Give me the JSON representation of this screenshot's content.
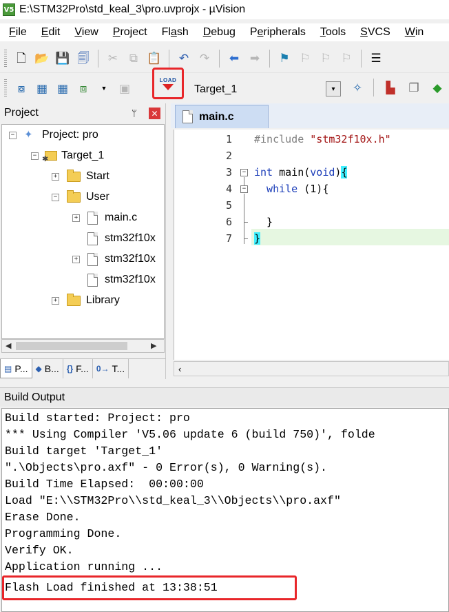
{
  "window": {
    "app_icon": "V5",
    "title": "E:\\STM32Pro\\std_keal_3\\pro.uvprojx - µVision"
  },
  "menu": [
    {
      "label": "File",
      "accel": "F",
      "rest": "ile"
    },
    {
      "label": "Edit",
      "accel": "E",
      "rest": "dit"
    },
    {
      "label": "View",
      "accel": "V",
      "rest": "iew"
    },
    {
      "label": "Project",
      "accel": "P",
      "rest": "roject"
    },
    {
      "label": "Flash",
      "accel": "a",
      "pre": "Fl",
      "rest": "sh"
    },
    {
      "label": "Debug",
      "accel": "D",
      "rest": "ebug"
    },
    {
      "label": "Peripherals",
      "accel": "e",
      "pre": "P",
      "rest": "ripherals"
    },
    {
      "label": "Tools",
      "accel": "T",
      "rest": "ools"
    },
    {
      "label": "SVCS",
      "accel": "S",
      "rest": "VCS"
    },
    {
      "label": "Win",
      "accel": "W",
      "rest": "in"
    }
  ],
  "toolbar": {
    "load_label": "LOAD",
    "target_name": "Target_1",
    "dropdown_glyph": "▾"
  },
  "project_panel": {
    "title": "Project",
    "pin_glyph": "ᛘ",
    "close_glyph": "✕",
    "tree": {
      "root": "Project: pro",
      "target": "Target_1",
      "groups": {
        "start": "Start",
        "user": "User",
        "library": "Library"
      },
      "files": [
        "main.c",
        "stm32f10x",
        "stm32f10x",
        "stm32f10x"
      ]
    },
    "tabs": [
      {
        "icon": "▤",
        "label": "P..."
      },
      {
        "icon": "◆",
        "label": "B..."
      },
      {
        "icon": "{}",
        "label": "F..."
      },
      {
        "icon": "0→",
        "label": "T..."
      }
    ]
  },
  "editor": {
    "tab_label": "main.c",
    "line_numbers": [
      "1",
      "2",
      "3",
      "4",
      "5",
      "6",
      "7"
    ],
    "code": {
      "l1_pre": "#include ",
      "l1_str": "\"stm32f10x.h\"",
      "l3_type": "int",
      "l3_mid": " main(",
      "l3_void": "void",
      "l3_end": ")",
      "l3_brace": "{",
      "l4_kw": "  while",
      "l4_rest": " (1){",
      "l6": "  }",
      "l7_brace": "}"
    }
  },
  "build_output": {
    "title": "Build Output",
    "lines": [
      "Build started: Project: pro",
      "*** Using Compiler 'V5.06 update 6 (build 750)', folde",
      "Build target 'Target_1'",
      "\".\\Objects\\pro.axf\" - 0 Error(s), 0 Warning(s).",
      "Build Time Elapsed:  00:00:00",
      "Load \"E:\\\\STM32Pro\\\\std_keal_3\\\\Objects\\\\pro.axf\"",
      "Erase Done.",
      "Programming Done.",
      "Verify OK.",
      "Application running ...",
      "Flash Load finished at 13:38:51"
    ]
  },
  "colors": {
    "highlight_red": "#e8262a",
    "brace_match": "#40f0ff",
    "current_line": "#e6f7e1",
    "tab_active": "#cdddf3"
  }
}
